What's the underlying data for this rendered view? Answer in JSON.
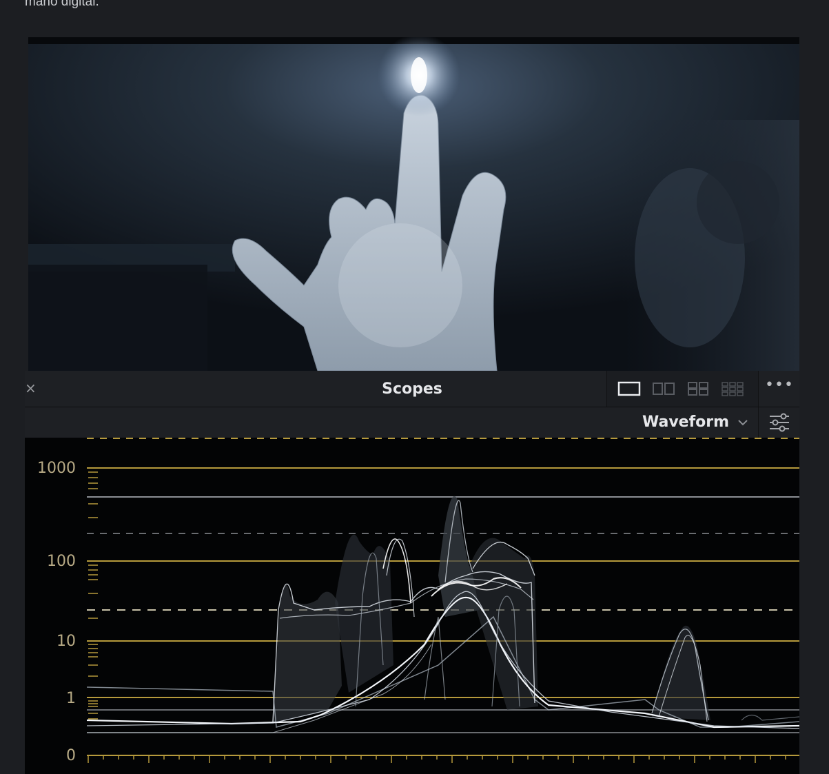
{
  "article": {
    "caption": "mano digital."
  },
  "scopes_panel": {
    "title": "Scopes",
    "close_glyph": "×",
    "more_glyph": "•••",
    "mode": "Waveform",
    "layout_icons": [
      "single-layout-icon",
      "dual-layout-icon",
      "quad-layout-icon",
      "grid-layout-icon"
    ],
    "settings_icon": "sliders-icon"
  },
  "waveform": {
    "scale": "log",
    "axis_ticks": [
      "1000",
      "100",
      "10",
      "1",
      "0"
    ],
    "grid_color": "#b69a3c",
    "trace_color": "#e8eef6"
  },
  "colors": {
    "background": "#1c1e22",
    "panel": "#1e2024",
    "scope_bg": "#030405",
    "tick_text": "#b8ab86"
  }
}
